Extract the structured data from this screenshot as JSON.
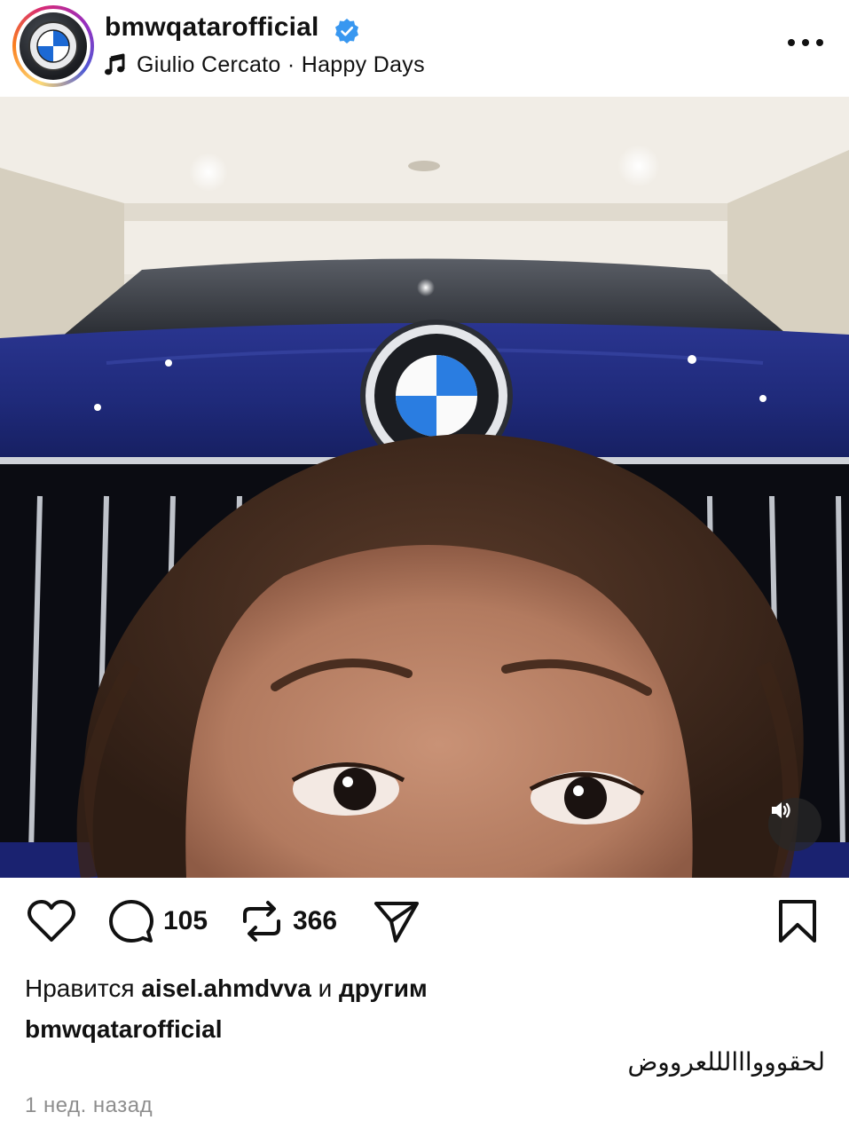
{
  "post": {
    "username": "bmwqatarofficial",
    "verified": true,
    "music": "Giulio Cercato · Happy Days",
    "comments_count": "105",
    "reposts_count": "366",
    "liked_by_prefix": "Нравится",
    "liked_by_user": "aisel.ahmdvva",
    "liked_by_connector": "и",
    "liked_by_others": "другим",
    "caption_user": "bmwqatarofficial",
    "caption_text": "لحقوووااالللعرووض",
    "time_ago": "1 нед. назад"
  },
  "colors": {
    "verified_blue": "#3897f0",
    "car_blue": "#1e2a7a",
    "text_primary": "#111111",
    "text_secondary": "#8e8e8e"
  },
  "icons": {
    "like": "heart-icon",
    "comment": "comment-icon",
    "repost": "repost-icon",
    "share": "send-icon",
    "save": "bookmark-icon",
    "more": "more-icon",
    "music": "music-note-icon",
    "sound": "speaker-icon"
  }
}
